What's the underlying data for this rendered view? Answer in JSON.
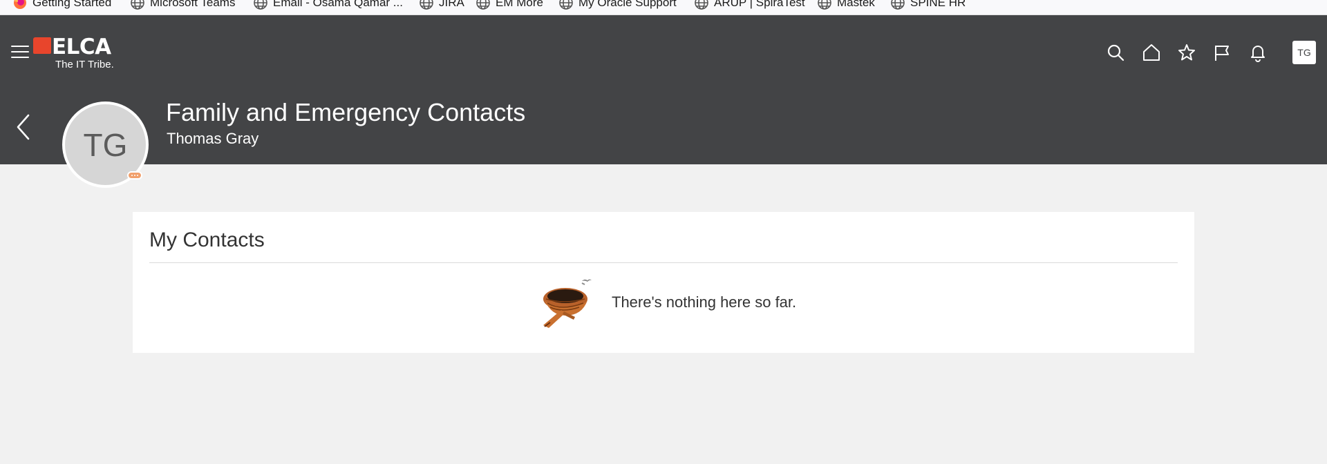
{
  "bookmarks": [
    {
      "label": "Getting Started",
      "icon": "firefox-icon"
    },
    {
      "label": "Microsoft Teams",
      "icon": "globe-icon"
    },
    {
      "label": "Email - Osama Qamar ...",
      "icon": "globe-icon"
    },
    {
      "label": "JIRA",
      "icon": "globe-icon"
    },
    {
      "label": "EM More",
      "icon": "globe-icon"
    },
    {
      "label": "My Oracle Support",
      "icon": "globe-icon"
    },
    {
      "label": "ARUP | SpiraTest",
      "icon": "globe-icon"
    },
    {
      "label": "Mastek",
      "icon": "globe-icon"
    },
    {
      "label": "SPINE HR",
      "icon": "globe-icon"
    }
  ],
  "header": {
    "logo_text": "ELCA",
    "logo_tagline": "The IT Tribe.",
    "icons": [
      "search-icon",
      "home-icon",
      "favorites-star-icon",
      "flag-icon",
      "notifications-bell-icon"
    ],
    "user_initials": "TG"
  },
  "page": {
    "title": "Family and Emergency Contacts",
    "subtitle": "Thomas Gray",
    "avatar_initials": "TG"
  },
  "contacts": {
    "title": "My Contacts",
    "empty_message": "There's nothing here so far."
  },
  "colors": {
    "header_bg": "#434446",
    "page_bg": "#f1f1f1",
    "logo_red": "#e8452c",
    "presence": "#f1a06c"
  }
}
